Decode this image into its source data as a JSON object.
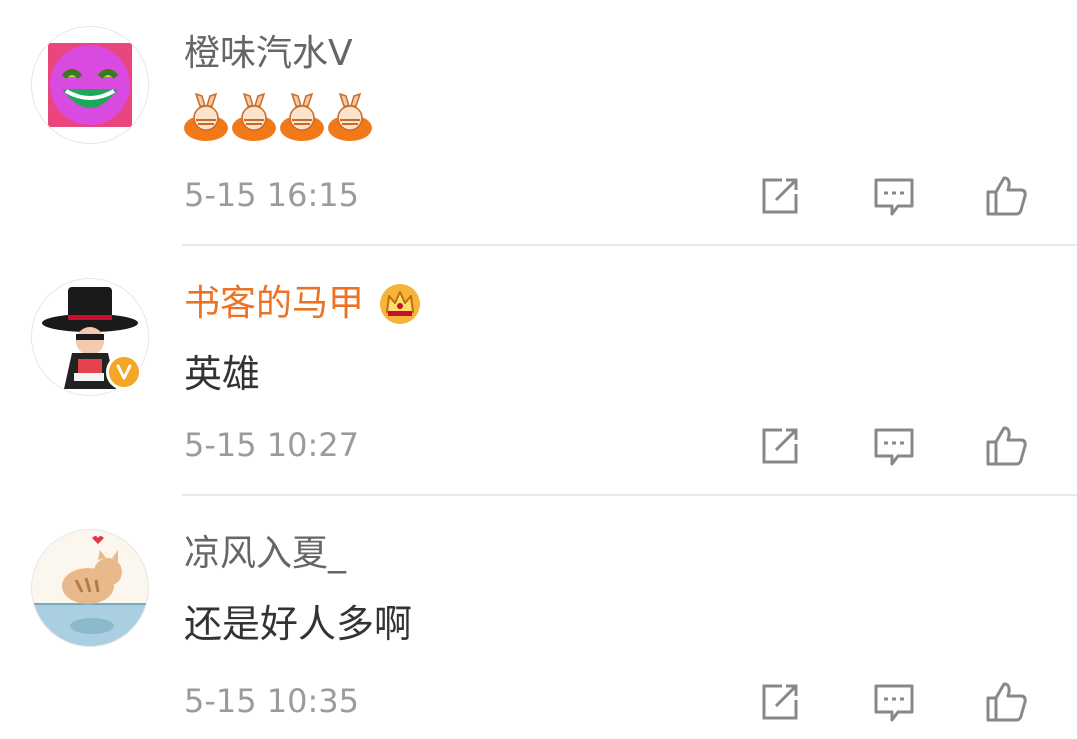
{
  "comments": [
    {
      "username": "橙味汽水V",
      "text": "",
      "emoji": [
        "rabbit-bowl-emoji",
        "rabbit-bowl-emoji",
        "rabbit-bowl-emoji",
        "rabbit-bowl-emoji"
      ],
      "timestamp": "5-15 16:15",
      "username_color": "#666666",
      "avatar": "laughing-pink-face-avatar"
    },
    {
      "username": "书客的马甲",
      "text": "英雄",
      "timestamp": "5-15 10:27",
      "username_color": "#ee7224",
      "badges": [
        "crown-icon",
        "verified-badge"
      ],
      "avatar": "top-hat-cartoon-avatar"
    },
    {
      "username": "凉风入夏_",
      "text": "还是好人多啊",
      "timestamp": "5-15 10:35",
      "username_color": "#666666",
      "avatar": "cartoon-cat-avatar"
    }
  ],
  "actions": [
    "repost-icon",
    "comment-icon",
    "like-icon"
  ],
  "colors": {
    "text_primary": "#333333",
    "text_secondary": "#666666",
    "timestamp": "#9b9b9b",
    "vip_name": "#ee7224",
    "icon": "#888888",
    "divider": "#e8e8e8",
    "verified_badge": "#f5a623"
  }
}
